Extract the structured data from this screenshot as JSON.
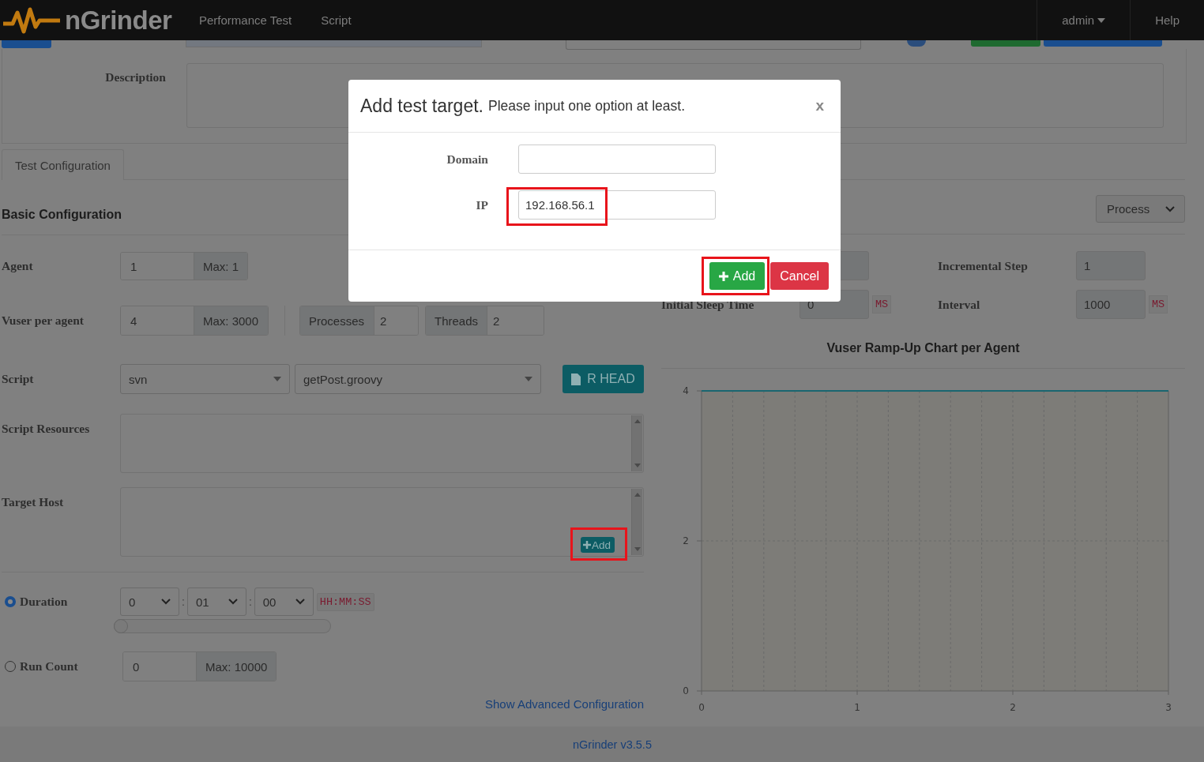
{
  "navbar": {
    "brand": "nGrinder",
    "menu": [
      {
        "label": "Performance Test"
      },
      {
        "label": "Script"
      }
    ],
    "user": "admin",
    "help": "Help"
  },
  "description": {
    "label": "Description"
  },
  "tabs": [
    {
      "label": "Test Configuration",
      "selected": true
    }
  ],
  "basic_configuration": {
    "title": "Basic Configuration",
    "agent": {
      "label": "Agent",
      "value": "1",
      "max": "Max: 1"
    },
    "vuser": {
      "label": "Vuser per agent",
      "value": "4",
      "max": "Max: 3000",
      "processes_label": "Processes",
      "processes": "2",
      "threads_label": "Threads",
      "threads": "2"
    },
    "script": {
      "label": "Script",
      "repository": "svn",
      "file": "getPost.groovy",
      "revision_button": "R HEAD"
    },
    "script_resources": {
      "label": "Script Resources"
    },
    "target_host": {
      "label": "Target Host",
      "add_button": {
        "label": "Add",
        "highlighted": true
      }
    },
    "duration": {
      "label": "Duration",
      "selected": true,
      "hours": "0",
      "separators": [
        ":",
        ":"
      ],
      "minutes": "01",
      "seconds": "00",
      "format": "HH:MM:SS",
      "level": 0
    },
    "run_count": {
      "label": "Run Count",
      "selected": false,
      "value": "0",
      "max": "Max: 10000"
    },
    "advanced_link": "Show Advanced Configuration"
  },
  "ramp_up": {
    "mode": "Process",
    "step_label": "Incremental Step",
    "step": "1",
    "initial_sleep_label": "Initial Sleep Time",
    "initial_sleep": "0",
    "initial_sleep_unit": "MS",
    "interval_label": "Interval",
    "interval": "1000",
    "interval_unit": "MS",
    "chart_title": "Vuser Ramp-Up Chart per Agent",
    "chart_data": {
      "type": "line",
      "x": [
        0,
        3
      ],
      "series": [
        {
          "color": "#1a6670",
          "values": [
            4,
            4
          ]
        }
      ],
      "grid": true,
      "xlim": [
        0,
        3
      ],
      "ylim": [
        0,
        4
      ],
      "xticks": [
        0,
        1,
        2,
        3
      ],
      "yticks": [
        0,
        2,
        4
      ]
    }
  },
  "modal": {
    "title": "Add test target.",
    "subtitle": "Please input one option at least.",
    "close": "x",
    "fields": [
      {
        "label": "Domain",
        "highlighted": false
      },
      {
        "label": "IP",
        "value": "192.168.56.1",
        "highlighted": true
      }
    ],
    "buttons": [
      {
        "label": "Add",
        "kind": "add",
        "highlighted": true
      },
      {
        "label": "Cancel",
        "kind": "cancel",
        "highlighted": false
      }
    ]
  },
  "footer": "nGrinder v3.5.5"
}
